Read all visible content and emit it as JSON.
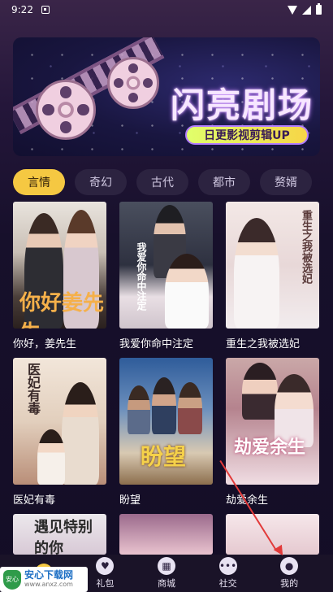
{
  "status_bar": {
    "time": "9:22"
  },
  "banner": {
    "title": "闪亮剧场",
    "subtitle": "日更影视剪辑UP"
  },
  "tabs": [
    {
      "label": "言情",
      "active": true
    },
    {
      "label": "奇幻",
      "active": false
    },
    {
      "label": "古代",
      "active": false
    },
    {
      "label": "都市",
      "active": false
    },
    {
      "label": "赘婿",
      "active": false
    }
  ],
  "dramas": [
    {
      "title": "你好，姜先生",
      "poster_text": "你好姜先生"
    },
    {
      "title": "我爱你命中注定",
      "poster_text": "我爱你命中注定"
    },
    {
      "title": "重生之我被选妃",
      "poster_text": "重生之我被选妃"
    },
    {
      "title": "医妃有毒",
      "poster_text": "医妃有毒"
    },
    {
      "title": "盼望",
      "poster_text": "盼望"
    },
    {
      "title": "劫爱余生",
      "poster_text": "劫爱余生"
    },
    {
      "title": "",
      "poster_text": "遇见特别的你"
    },
    {
      "title": "",
      "poster_text": ""
    },
    {
      "title": "",
      "poster_text": ""
    }
  ],
  "bottom_nav": [
    {
      "label": "",
      "icon": "home-icon",
      "active": true
    },
    {
      "label": "礼包",
      "icon": "gift-icon",
      "active": false
    },
    {
      "label": "商城",
      "icon": "shop-icon",
      "active": false
    },
    {
      "label": "社交",
      "icon": "chat-icon",
      "active": false
    },
    {
      "label": "我的",
      "icon": "user-icon",
      "active": false
    }
  ],
  "watermark": {
    "title": "安心下载网",
    "url": "www.anxz.com",
    "badge": "安心"
  },
  "colors": {
    "accent": "#f5c842",
    "background": "#17102b",
    "tab_bg": "#2c2340"
  }
}
